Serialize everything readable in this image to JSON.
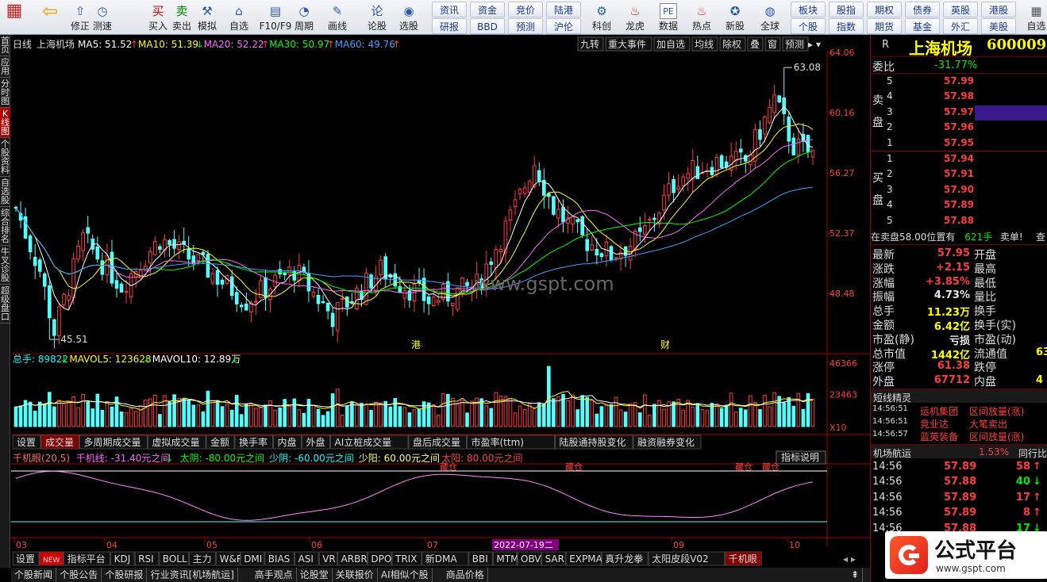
{
  "toolbar": {
    "icons": [
      {
        "label": "",
        "icon": "windows-icon"
      },
      {
        "label": "",
        "icon": "back-arrow-icon"
      },
      {
        "label": "修正",
        "icon": "repair-icon"
      },
      {
        "label": "测速",
        "icon": "stopwatch-icon"
      },
      {
        "label": "买入",
        "icon": "buy-icon",
        "glyph": "买"
      },
      {
        "label": "卖出",
        "icon": "sell-icon",
        "glyph": "卖"
      },
      {
        "label": "模拟",
        "icon": "hammer-icon"
      },
      {
        "label": "自选",
        "icon": "home-icon"
      },
      {
        "label": "F10/F9",
        "icon": "f10-icon"
      },
      {
        "label": "周期",
        "icon": "cycle-icon"
      },
      {
        "label": "画线",
        "icon": "pencil-icon"
      },
      {
        "label": "论股",
        "icon": "discuss-icon",
        "glyph": "论"
      },
      {
        "label": "选股",
        "icon": "select-icon"
      }
    ],
    "group1": [
      "资讯",
      "资金",
      "竞价",
      "陆港",
      "科创"
    ],
    "group1b": [
      "研报",
      "BBD",
      "预测",
      "沪伦"
    ],
    "icons2": [
      {
        "label": "科创",
        "icon": "sci-icon"
      },
      {
        "label": "龙虎",
        "icon": "dragon-icon"
      },
      {
        "label": "数据",
        "icon": "pe-icon",
        "glyph": "PE"
      },
      {
        "label": "热点",
        "icon": "hot-icon"
      },
      {
        "label": "新股",
        "icon": "newstock-icon"
      },
      {
        "label": "全球",
        "icon": "globe-icon"
      }
    ],
    "group2a": [
      "板块",
      "股指",
      "期权",
      "债券",
      "英股",
      "港股"
    ],
    "group2b": [
      "个股",
      "指数",
      "期货",
      "基金",
      "外汇",
      "美股"
    ],
    "last": "自选"
  },
  "leftbar": [
    "首页",
    "应用",
    "分时图",
    "K线图",
    "个股资料",
    "自选股",
    "综合排名",
    "牛叉诊股",
    "超级盘口"
  ],
  "chart_data": {
    "type": "candlestick",
    "title": "日线",
    "stock_name": "上海机场",
    "ma_labels": [
      {
        "text": "MA5: 51.52",
        "arrow": "↑",
        "color": "#ffffff"
      },
      {
        "text": "MA10: 51.39",
        "arrow": "↓",
        "color": "#ffff00"
      },
      {
        "text": "MA20: 52.22",
        "arrow": "↑",
        "color": "#ff66ff"
      },
      {
        "text": "MA30: 50.97",
        "arrow": "↑",
        "color": "#00ff00"
      },
      {
        "text": "MA60: 49.76",
        "arrow": "↑",
        "color": "#40a0ff"
      }
    ],
    "top_buttons": [
      "九转",
      "重大事件",
      "加自选",
      "均线",
      "除权",
      "叠",
      "窗",
      "预测"
    ],
    "price_ticks": [
      "64.06",
      "60.16",
      "56.27",
      "52.37",
      "48.48"
    ],
    "ylim": [
      44.59,
      64.06
    ],
    "high_label": "63.08",
    "low_label": "45.51",
    "watermark": "www.gspt.com",
    "markers": [
      "港",
      "财"
    ],
    "volume": {
      "header": [
        {
          "text": "总手: 89822",
          "arrow": "↓",
          "color": "#00ffff"
        },
        {
          "text": "MAVOL5: 123628",
          "arrow": "↓",
          "color": "#ffff00"
        },
        {
          "text": "MAVOL10: 12.89万",
          "arrow": "↓",
          "color": "#ffffff"
        }
      ],
      "ticks": [
        "46366",
        "23463"
      ],
      "unit": "X10",
      "ylim": [
        0,
        46366
      ]
    },
    "vol_tabs": [
      "设置",
      "成交量",
      "多周期成交量",
      "虚拟成交量",
      "金额",
      "换手率",
      "内盘",
      "外盘",
      "AI立桩成交量",
      "盘后成交量",
      "市盈率(ttm)",
      "陆股通持股变化",
      "融资融券变化"
    ],
    "indicator": {
      "header": [
        {
          "text": "千机眼(20,5)",
          "color": "#ff6666"
        },
        {
          "text": "千机线: -31.40元之间",
          "arrow": "↓",
          "color": "#ff66ff"
        },
        {
          "text": "太阴: -80.00元之间",
          "color": "#00ff00"
        },
        {
          "text": "少阴: -60.00元之间",
          "color": "#00ffff"
        },
        {
          "text": "少阳: 60.00元之间",
          "color": "#ffff66"
        },
        {
          "text": "太阳: 80.00元之间",
          "color": "#ff4040"
        }
      ],
      "desc_button": "指标说明",
      "marks": [
        "藏仓",
        "藏仓",
        "藏仓",
        "藏仓"
      ],
      "ylim": [
        -100,
        100
      ]
    },
    "x_ticks": [
      "03",
      "04",
      "05",
      "06",
      "07",
      "09",
      "10"
    ],
    "cursor_date": "2022-07-19二",
    "indicator_tabs": [
      "设置",
      "NEW",
      "指标平台",
      "KDJ",
      "RSI",
      "BOLL",
      "主力",
      "W&R",
      "DMI",
      "BIAS",
      "ASI",
      "VR",
      "ARBR",
      "DPO",
      "TRIX",
      "新DMA",
      "BBI",
      "MTM",
      "OBV",
      "SAR",
      "EXPMA",
      "真升龙拳",
      "太阳皮段V02",
      "千机眼"
    ],
    "bottom_tabs": [
      "个股新闻",
      "个股公告",
      "个股研报",
      "行业资讯[机场航运]",
      "高手观点",
      "论股堂",
      "关联报价",
      "AI相似个股",
      "商品价格"
    ]
  },
  "side": {
    "r": "R",
    "name": "上海机场",
    "code": "600009",
    "weibi_label": "委比",
    "weibi": "-31.77%",
    "sell_label": "卖盘",
    "buy_label": "买盘",
    "asks": [
      {
        "n": "5",
        "p": "57.99"
      },
      {
        "n": "4",
        "p": "57.98"
      },
      {
        "n": "3",
        "p": "57.97"
      },
      {
        "n": "2",
        "p": "57.96"
      },
      {
        "n": "1",
        "p": "57.95"
      }
    ],
    "bids": [
      {
        "n": "1",
        "p": "57.94"
      },
      {
        "n": "2",
        "p": "57.91"
      },
      {
        "n": "3",
        "p": "57.90"
      },
      {
        "n": "4",
        "p": "57.89"
      },
      {
        "n": "5",
        "p": "57.88"
      }
    ],
    "notice_a": "在卖盘58.00位置有",
    "notice_b": "621手",
    "notice_c": "卖单!",
    "notice_d": "查",
    "quote": [
      {
        "l1": "最新",
        "v1": "57.95",
        "l2": "开盘",
        "c": "red"
      },
      {
        "l1": "涨跌",
        "v1": "+2.15",
        "l2": "最高",
        "c": "red"
      },
      {
        "l1": "涨幅",
        "v1": "+3.85%",
        "l2": "最低",
        "c": "red"
      },
      {
        "l1": "振幅",
        "v1": "4.73%",
        "l2": "量比",
        "c": "wht"
      },
      {
        "l1": "总手",
        "v1": "11.23万",
        "l2": "换手",
        "c": "yel"
      },
      {
        "l1": "金额",
        "v1": "6.42亿",
        "l2": "换手(实)",
        "c": "yel"
      },
      {
        "l1": "市盈(静)",
        "v1": "亏损",
        "l2": "市盈(动)",
        "c": "wht"
      },
      {
        "l1": "总市值",
        "v1": "1442亿",
        "l2": "流通值",
        "c": "yel",
        "v2": "63"
      },
      {
        "l1": "涨停",
        "v1": "61.38",
        "l2": "跌停",
        "c": "red"
      },
      {
        "l1": "外盘",
        "v1": "67712",
        "l2": "内盘",
        "c": "red",
        "v2": "4"
      }
    ],
    "jingling_title": "短线精灵",
    "jingling": [
      {
        "t": "14:56:51",
        "s": "运机集团",
        "e": "区间放量(涨)"
      },
      {
        "t": "14:56:51",
        "s": "竞业达",
        "e": "大笔卖出"
      },
      {
        "t": "14:56:57",
        "s": "蓝英装备",
        "e": "区间放量(涨)"
      }
    ],
    "industry": "机场航运",
    "industry_pct": "1.53%",
    "industry_btn": "同行比",
    "ticks": [
      {
        "t": "14:56",
        "p": "57.89",
        "v": "58",
        "d": "up"
      },
      {
        "t": "14:56",
        "p": "57.88",
        "v": "40",
        "d": "down"
      },
      {
        "t": "14:56",
        "p": "57.89",
        "v": "17",
        "d": "up"
      },
      {
        "t": "14:56",
        "p": "57.89",
        "v": "8",
        "d": "up"
      },
      {
        "t": "14:56",
        "p": "57.88",
        "v": "17",
        "d": "down"
      }
    ],
    "logo_text": "公式平台",
    "logo_url": "www.gspt.com"
  }
}
